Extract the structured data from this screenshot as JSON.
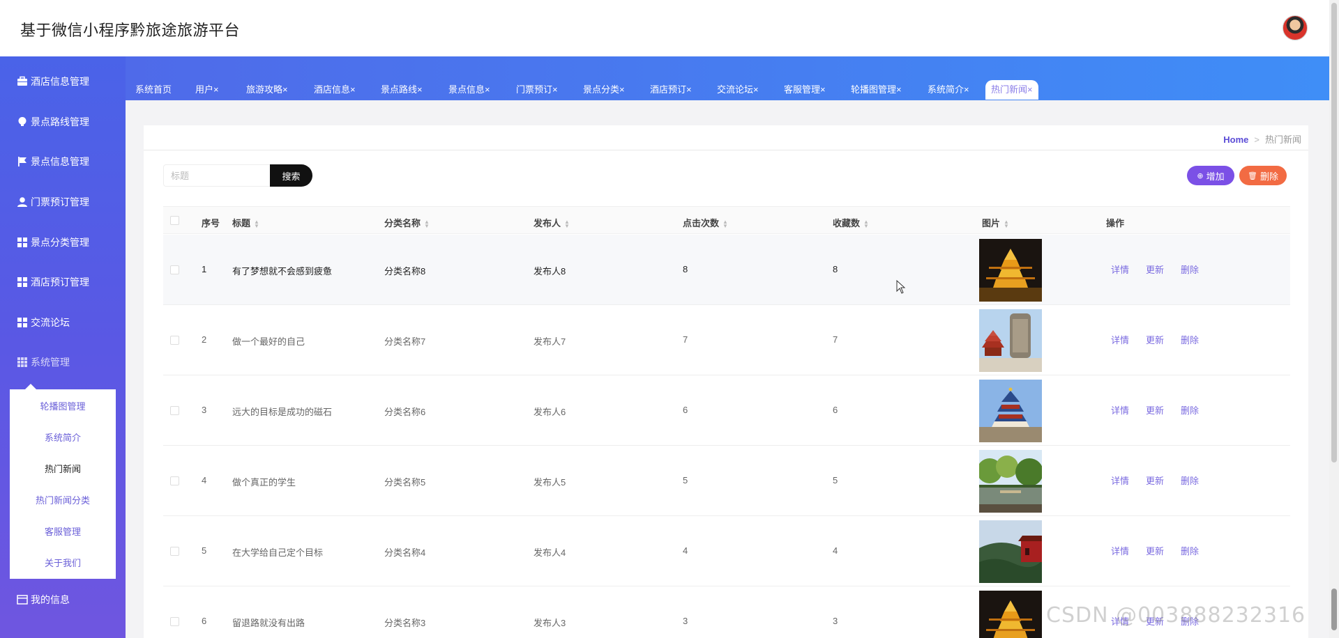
{
  "header": {
    "title": "基于微信小程序黔旅途旅游平台"
  },
  "sidebar": {
    "items": [
      {
        "label": "酒店信息管理",
        "icon": "briefcase-icon"
      },
      {
        "label": "景点路线管理",
        "icon": "bulb-icon"
      },
      {
        "label": "景点信息管理",
        "icon": "flag-icon"
      },
      {
        "label": "门票预订管理",
        "icon": "user-icon"
      },
      {
        "label": "景点分类管理",
        "icon": "grid-icon"
      },
      {
        "label": "酒店预订管理",
        "icon": "grid-icon"
      },
      {
        "label": "交流论坛",
        "icon": "grid-icon"
      },
      {
        "label": "系统管理",
        "icon": "apps-icon"
      },
      {
        "label": "我的信息",
        "icon": "card-icon"
      }
    ],
    "submenu": [
      {
        "label": "轮播图管理"
      },
      {
        "label": "系统简介"
      },
      {
        "label": "热门新闻",
        "active": true
      },
      {
        "label": "热门新闻分类"
      },
      {
        "label": "客服管理"
      },
      {
        "label": "关于我们"
      }
    ]
  },
  "tabs": [
    {
      "label": "系统首页"
    },
    {
      "label": "用户×"
    },
    {
      "label": "旅游攻略×"
    },
    {
      "label": "酒店信息×"
    },
    {
      "label": "景点路线×"
    },
    {
      "label": "景点信息×"
    },
    {
      "label": "门票预订×"
    },
    {
      "label": "景点分类×"
    },
    {
      "label": "酒店预订×"
    },
    {
      "label": "交流论坛×"
    },
    {
      "label": "客服管理×"
    },
    {
      "label": "轮播图管理×"
    },
    {
      "label": "系统简介×"
    },
    {
      "label": "热门新闻×",
      "active": true
    }
  ],
  "breadcrumb": {
    "home": "Home",
    "current": "热门新闻"
  },
  "search": {
    "placeholder": "标题",
    "button": "搜索"
  },
  "actions": {
    "add": "增加",
    "delete": "删除"
  },
  "table": {
    "headers": [
      "序号",
      "标题",
      "分类名称",
      "发布人",
      "点击次数",
      "收藏数",
      "图片",
      "操作"
    ],
    "row_actions": [
      "详情",
      "更新",
      "删除"
    ],
    "rows": [
      {
        "no": "1",
        "title": "有了梦想就不会感到疲惫",
        "category": "分类名称8",
        "publisher": "发布人8",
        "clicks": "8",
        "favorites": "8",
        "image": "night-tower"
      },
      {
        "no": "2",
        "title": "做一个最好的自己",
        "category": "分类名称7",
        "publisher": "发布人7",
        "clicks": "7",
        "favorites": "7",
        "image": "stele-pagoda"
      },
      {
        "no": "3",
        "title": "远大的目标是成功的磁石",
        "category": "分类名称6",
        "publisher": "发布人6",
        "clicks": "6",
        "favorites": "6",
        "image": "temple-of-heaven"
      },
      {
        "no": "4",
        "title": "做个真正的学生",
        "category": "分类名称5",
        "publisher": "发布人5",
        "clicks": "5",
        "favorites": "5",
        "image": "lake-park"
      },
      {
        "no": "5",
        "title": "在大学给自己定个目标",
        "category": "分类名称4",
        "publisher": "发布人4",
        "clicks": "4",
        "favorites": "4",
        "image": "great-wall"
      },
      {
        "no": "6",
        "title": "留退路就没有出路",
        "category": "分类名称3",
        "publisher": "发布人3",
        "clicks": "3",
        "favorites": "3",
        "image": "night-tower"
      }
    ]
  },
  "watermark": "CSDN @003888232316",
  "colors": {
    "accent": "#7b50e6",
    "danger": "#f26b43",
    "sidebar_top": "#4a63e8",
    "link": "#7b6be0"
  }
}
